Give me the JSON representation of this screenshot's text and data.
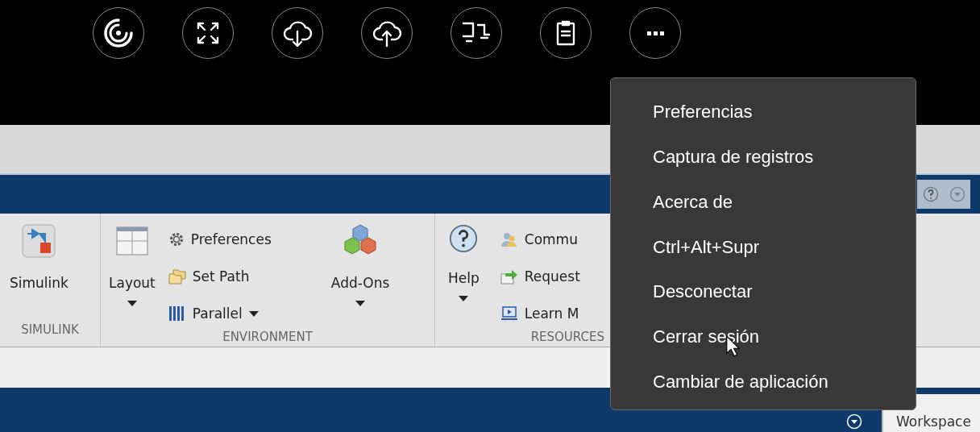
{
  "ribbon": {
    "simulink": {
      "button": "Simulink",
      "section": "SIMULINK"
    },
    "environment": {
      "layout": {
        "label": "Layout",
        "dropdown": true
      },
      "small_buttons": [
        {
          "label": "Preferences",
          "dropdown": false
        },
        {
          "label": "Set Path",
          "dropdown": false
        },
        {
          "label": "Parallel",
          "dropdown": true
        }
      ],
      "addons": {
        "label": "Add-Ons",
        "dropdown": true
      },
      "section": "ENVIRONMENT"
    },
    "resources": {
      "help": {
        "label": "Help",
        "dropdown": true
      },
      "links": [
        "Commu",
        "Request",
        "Learn M"
      ],
      "section": "RESOURCES"
    }
  },
  "menu": {
    "items": [
      "Preferencias",
      "Captura de registros",
      "Acerca de",
      "Ctrl+Alt+Supr",
      "Desconectar",
      "Cerrar sesión",
      "Cambiar de aplicación"
    ]
  },
  "panel": {
    "tab": "Workspace"
  }
}
